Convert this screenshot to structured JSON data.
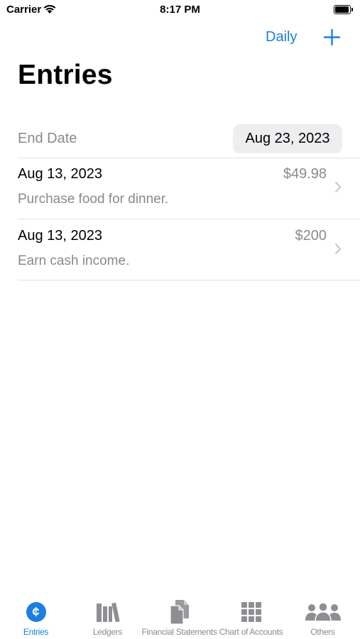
{
  "status_bar": {
    "carrier": "Carrier",
    "time": "8:17 PM"
  },
  "nav": {
    "daily_label": "Daily"
  },
  "page": {
    "title": "Entries"
  },
  "filter": {
    "end_date_label": "End Date",
    "end_date_value": "Aug 23, 2023"
  },
  "entries": [
    {
      "date": "Aug 13, 2023",
      "amount": "$49.98",
      "description": "Purchase food for dinner."
    },
    {
      "date": "Aug 13, 2023",
      "amount": "$200",
      "description": "Earn cash income."
    }
  ],
  "tabs": [
    {
      "label": "Entries",
      "icon": "cent-sign-icon",
      "active": true
    },
    {
      "label": "Ledgers",
      "icon": "books-icon",
      "active": false
    },
    {
      "label": "Financial Statements",
      "icon": "documents-icon",
      "active": false
    },
    {
      "label": "Chart of Accounts",
      "icon": "grid-icon",
      "active": false
    },
    {
      "label": "Others",
      "icon": "people-icon",
      "active": false
    }
  ],
  "colors": {
    "accent": "#1a7fe0",
    "secondary_text": "#8a8a8e",
    "inactive_icon": "#8e8e93"
  }
}
